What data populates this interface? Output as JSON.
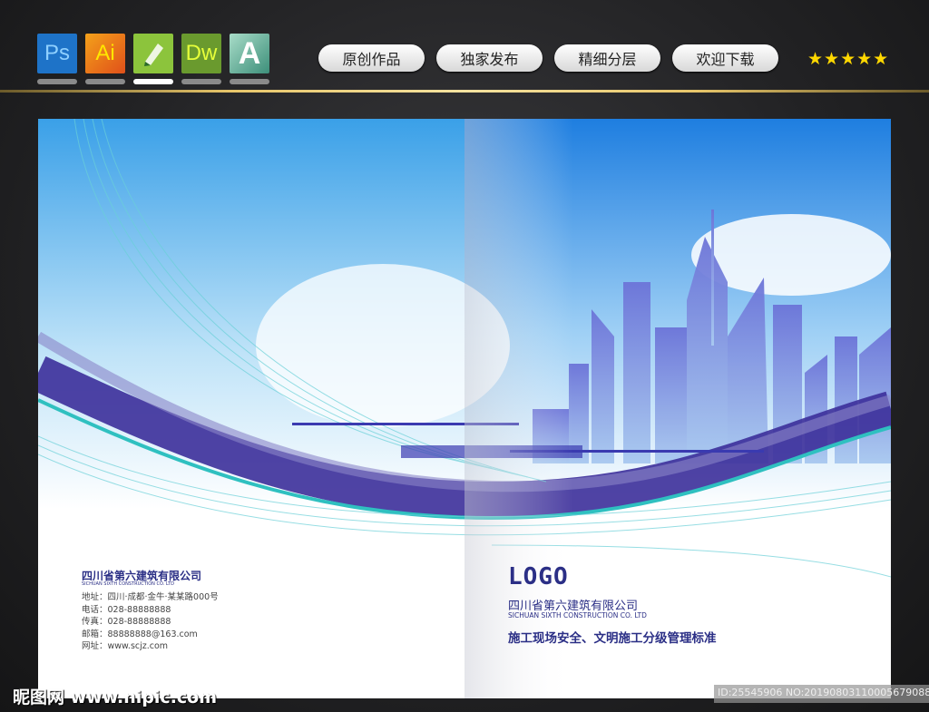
{
  "toolbar": {
    "apps": [
      {
        "label": "Ps",
        "color": "#1e73c8"
      },
      {
        "label": "Ai",
        "color": "#f08a10"
      },
      {
        "label": "",
        "color": "#8cc43c"
      },
      {
        "label": "Dw",
        "color": "#6a9a2e"
      },
      {
        "label": "A",
        "color": "#5aa894"
      }
    ],
    "buttons": [
      "原创作品",
      "独家发布",
      "精细分层",
      "欢迎下载"
    ],
    "rating": "★★★★★"
  },
  "cover": {
    "back": {
      "company_cn": "四川省第六建筑有限公司",
      "company_en": "SICHUAN SIXTH CONSTRUCTION CO. LTD",
      "contact": [
        "地址：四川·成都·金牛·某某路000号",
        "电话：028-88888888",
        "传真：028-88888888",
        "邮箱：88888888@163.com",
        "网址：www.scjz.com"
      ]
    },
    "front": {
      "logo": "LOGO",
      "company_cn": "四川省第六建筑有限公司",
      "company_en": "SICHUAN SIXTH CONSTRUCTION CO. LTD",
      "title": "施工现场安全、文明施工分级管理标准"
    }
  },
  "footer": {
    "watermark": "昵图网 www.nipic.com",
    "id_text": "ID:25545906 NO:20190803110005679088"
  },
  "colors": {
    "accent": "#2b2f86",
    "gold": "#e8c66a"
  }
}
